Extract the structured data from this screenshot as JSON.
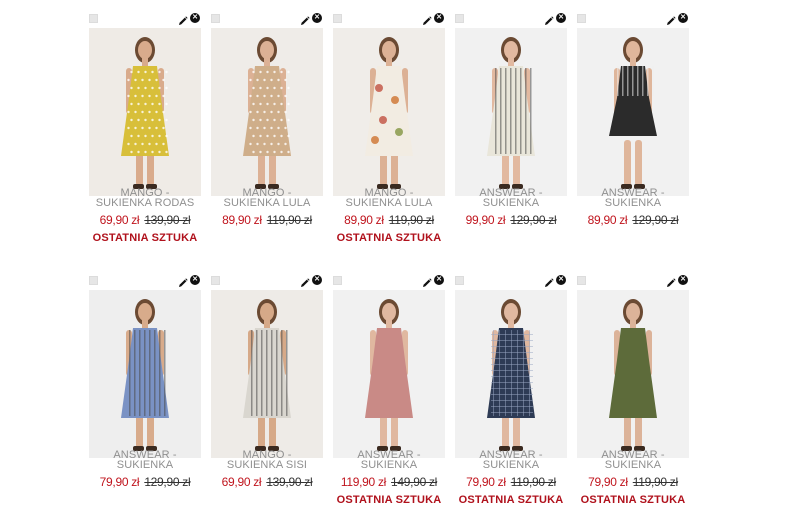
{
  "products": [
    {
      "brand": "MANGO -",
      "name": "SUKIENKA RODAS",
      "price": "69,90 zł",
      "old_price": "139,90 zł",
      "status": "OSTATNIA SZTUKA",
      "bg": "#efebe6",
      "dress": "#d8bf3a",
      "pattern": "dots",
      "skin": "#d9ab8c"
    },
    {
      "brand": "MANGO -",
      "name": "SUKIENKA LULA",
      "price": "89,90 zł",
      "old_price": "119,90 zł",
      "status": "",
      "bg": "#efece8",
      "dress": "#cfae8a",
      "pattern": "dots",
      "skin": "#dcb195"
    },
    {
      "brand": "MANGO -",
      "name": "SUKIENKA LULA",
      "price": "89,90 zł",
      "old_price": "119,90 zł",
      "status": "OSTATNIA SZTUKA",
      "bg": "#f0ede9",
      "dress": "#f2ece2",
      "pattern": "flowers",
      "skin": "#dcb195"
    },
    {
      "brand": "ANSWEAR -",
      "name": "SUKIENKA",
      "price": "99,90 zł",
      "old_price": "129,90 zł",
      "status": "",
      "bg": "#f1f1f1",
      "dress": "#e9e6da",
      "pattern": "stripes",
      "skin": "#e2b9a0"
    },
    {
      "brand": "ANSWEAR -",
      "name": "SUKIENKA",
      "price": "89,90 zł",
      "old_price": "129,90 zł",
      "status": "",
      "bg": "#f1f1f1",
      "dress": "#2b2b2b",
      "pattern": "top-stripes",
      "skin": "#dfb69b"
    },
    {
      "brand": "ANSWEAR -",
      "name": "SUKIENKA",
      "price": "79,90 zł",
      "old_price": "129,90 zł",
      "status": "",
      "bg": "#eeeeee",
      "dress": "#7a92c4",
      "pattern": "stripes",
      "skin": "#d8ab8b"
    },
    {
      "brand": "MANGO -",
      "name": "SUKIENKA SISI",
      "price": "69,90 zł",
      "old_price": "139,90 zł",
      "status": "",
      "bg": "#eeebe7",
      "dress": "#d9d6cf",
      "pattern": "stripes",
      "skin": "#d6a988"
    },
    {
      "brand": "ANSWEAR -",
      "name": "SUKIENKA",
      "price": "119,90 zł",
      "old_price": "149,90 zł",
      "status": "OSTATNIA SZTUKA",
      "bg": "#f1f1f1",
      "dress": "#c98a86",
      "pattern": "plain",
      "skin": "#e0b8a0"
    },
    {
      "brand": "ANSWEAR -",
      "name": "SUKIENKA",
      "price": "79,90 zł",
      "old_price": "119,90 zł",
      "status": "OSTATNIA SZTUKA",
      "bg": "#f1f1f1",
      "dress": "#2e3b55",
      "pattern": "check",
      "skin": "#e0b8a0"
    },
    {
      "brand": "ANSWEAR -",
      "name": "SUKIENKA",
      "price": "79,90 zł",
      "old_price": "119,90 zł",
      "status": "OSTATNIA SZTUKA",
      "bg": "#f1f1f1",
      "dress": "#5d6b3a",
      "pattern": "plain",
      "skin": "#dcb399"
    }
  ],
  "icons": {
    "edit": "pencil-icon",
    "remove": "close-circle-icon",
    "select": "checkbox"
  },
  "colors": {
    "price": "#c0151e",
    "status": "#b0111c",
    "brand": "#8f8f8f"
  }
}
